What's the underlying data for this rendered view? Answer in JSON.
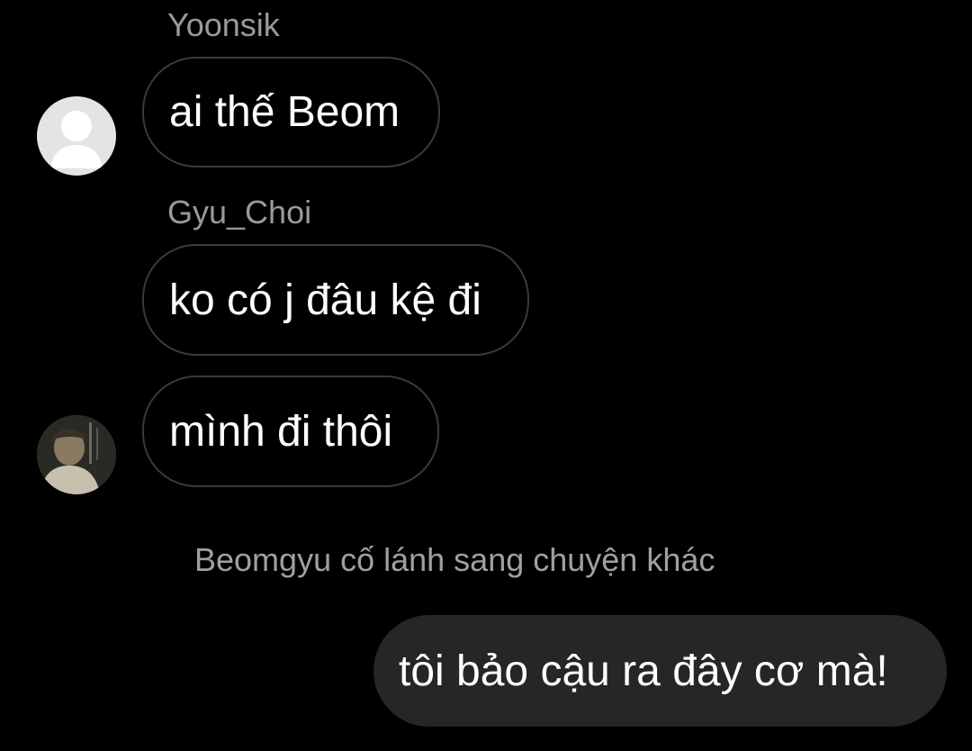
{
  "messages": [
    {
      "sender": "Yoonsik",
      "text": "ai thế Beom",
      "avatar": "default-avatar-icon"
    },
    {
      "sender": "Gyu_Choi",
      "text": "ko có j đâu kệ đi"
    },
    {
      "text": "mình đi thôi",
      "avatar": "profile-photo"
    }
  ],
  "system_note": "Beomgyu cố lánh sang chuyện khác",
  "outgoing": {
    "text": "tôi bảo cậu ra đây cơ mà!"
  },
  "colors": {
    "background": "#000000",
    "incoming_border": "#3a3a3a",
    "outgoing_bubble": "#262626",
    "sender_name": "#9a9a9a",
    "text": "#ffffff"
  }
}
